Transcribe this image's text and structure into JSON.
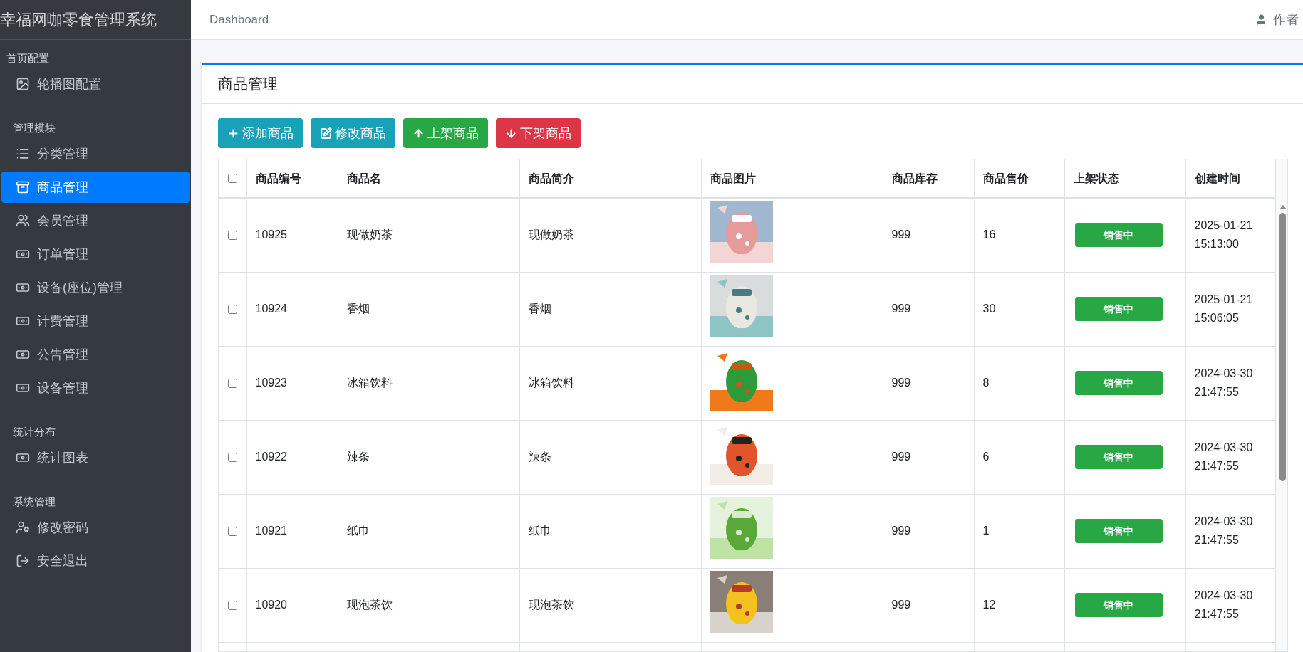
{
  "sidebar": {
    "title": "幸福网咖零食管理系统",
    "sections": [
      {
        "label": "首页配置",
        "items": [
          {
            "label": "轮播图配置",
            "selected": false
          }
        ]
      },
      {
        "label": "管理模块",
        "items": [
          {
            "label": "分类管理",
            "selected": false
          },
          {
            "label": "商品管理",
            "selected": true
          },
          {
            "label": "会员管理",
            "selected": false
          },
          {
            "label": "订单管理",
            "selected": false
          },
          {
            "label": "设备(座位)管理",
            "selected": false
          },
          {
            "label": "计费管理",
            "selected": false
          },
          {
            "label": "公告管理",
            "selected": false
          },
          {
            "label": "设备管理",
            "selected": false
          }
        ]
      },
      {
        "label": "统计分布",
        "items": [
          {
            "label": "统计图表",
            "selected": false
          }
        ]
      },
      {
        "label": "系统管理",
        "items": [
          {
            "label": "修改密码",
            "selected": false
          },
          {
            "label": "安全退出",
            "selected": false
          }
        ]
      }
    ]
  },
  "header": {
    "breadcrumb": "Dashboard",
    "user": "作者"
  },
  "card": {
    "title": "商品管理",
    "buttons": [
      {
        "label": "添加商品",
        "kind": "add"
      },
      {
        "label": "修改商品",
        "kind": "edit"
      },
      {
        "label": "上架商品",
        "kind": "up"
      },
      {
        "label": "下架商品",
        "kind": "down"
      }
    ],
    "table": {
      "select_all_checked": false,
      "columns": [
        "商品编号",
        "商品名",
        "商品简介",
        "商品图片",
        "商品库存",
        "商品售价",
        "上架状态",
        "创建时间"
      ],
      "rows": [
        {
          "checked": false,
          "id": "10925",
          "name": "现做奶茶",
          "intro": "现做奶茶",
          "stock": "999",
          "price": "16",
          "status": {
            "label": "销售中",
            "kind": "on_sale"
          },
          "created": [
            "2025-01-21",
            "15:13:00"
          ]
        },
        {
          "checked": false,
          "id": "10924",
          "name": "香烟",
          "intro": "香烟",
          "stock": "999",
          "price": "30",
          "status": {
            "label": "销售中",
            "kind": "on_sale"
          },
          "created": [
            "2025-01-21",
            "15:06:05"
          ]
        },
        {
          "checked": false,
          "id": "10923",
          "name": "冰箱饮料",
          "intro": "冰箱饮料",
          "stock": "999",
          "price": "8",
          "status": {
            "label": "销售中",
            "kind": "on_sale"
          },
          "created": [
            "2024-03-30",
            "21:47:55"
          ]
        },
        {
          "checked": false,
          "id": "10922",
          "name": "辣条",
          "intro": "辣条",
          "stock": "999",
          "price": "6",
          "status": {
            "label": "销售中",
            "kind": "on_sale"
          },
          "created": [
            "2024-03-30",
            "21:47:55"
          ]
        },
        {
          "checked": false,
          "id": "10921",
          "name": "纸巾",
          "intro": "纸巾",
          "stock": "999",
          "price": "1",
          "status": {
            "label": "销售中",
            "kind": "on_sale"
          },
          "created": [
            "2024-03-30",
            "21:47:55"
          ]
        },
        {
          "checked": false,
          "id": "10920",
          "name": "现泡茶饮",
          "intro": "现泡茶饮",
          "stock": "999",
          "price": "12",
          "status": {
            "label": "销售中",
            "kind": "on_sale"
          },
          "created": [
            "2024-03-30",
            "21:47:55"
          ]
        }
      ]
    }
  }
}
